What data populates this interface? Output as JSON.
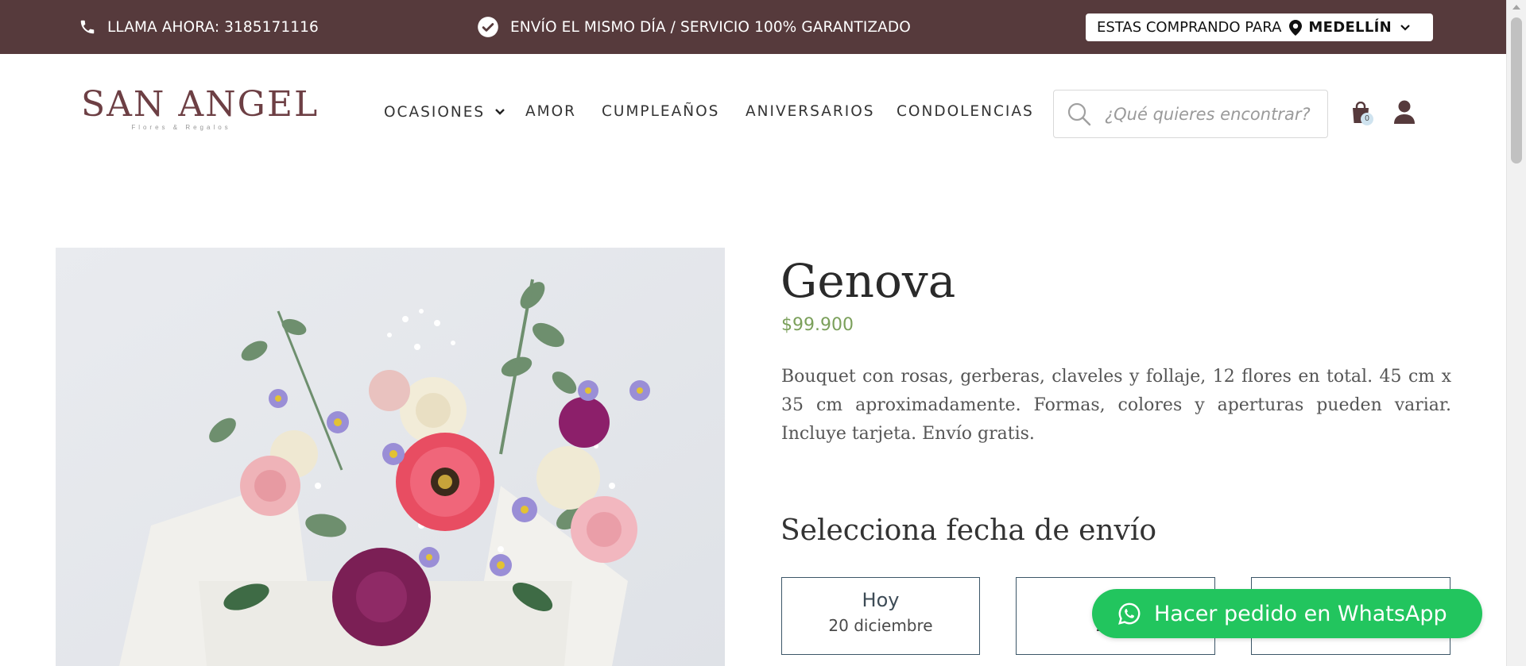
{
  "topbar": {
    "phone_text": "LLAMA AHORA: 3185171116",
    "shipping_text": "ENVÍO EL MISMO DÍA / SERVICIO 100% GARANTIZADO",
    "location_prefix": "ESTAS COMPRANDO PARA",
    "location_city": "MEDELLÍN"
  },
  "header": {
    "logo_title": "SAN ANGEL",
    "logo_subtitle": "Flores & Regalos",
    "nav": [
      "OCASIONES",
      "AMOR",
      "CUMPLEAÑOS",
      "ANIVERSARIOS",
      "CONDOLENCIAS"
    ],
    "search_placeholder": "¿Qué quieres encontrar?",
    "cart_count": "0"
  },
  "product": {
    "name": "Genova",
    "price": "$99.900",
    "description": "Bouquet con rosas, gerberas, claveles y follaje, 12 flores en total. 45  cm x 35 cm aproximadamente. Formas, colores y aperturas pueden variar. Incluye tarjeta. Envío gratis."
  },
  "delivery": {
    "title": "Selecciona fecha de envío",
    "options": [
      {
        "label": "Hoy",
        "date": "20 diciembre"
      },
      {
        "label": "M",
        "date": "21 di"
      },
      {
        "label": "",
        "date": ""
      }
    ]
  },
  "whatsapp": {
    "label": "Hacer pedido en WhatsApp"
  },
  "colors": {
    "topbar": "#563a3c",
    "brand": "#6d3f44",
    "price": "#7ba05b",
    "whatsapp": "#22c55e",
    "date_border": "#3c5668"
  },
  "icons": {
    "phone": "phone-icon",
    "check": "check-circle-icon",
    "pin": "map-pin-icon",
    "chevron": "chevron-down-icon",
    "search": "search-icon",
    "cart": "shopping-bag-icon",
    "user": "user-icon",
    "whatsapp": "whatsapp-icon"
  }
}
